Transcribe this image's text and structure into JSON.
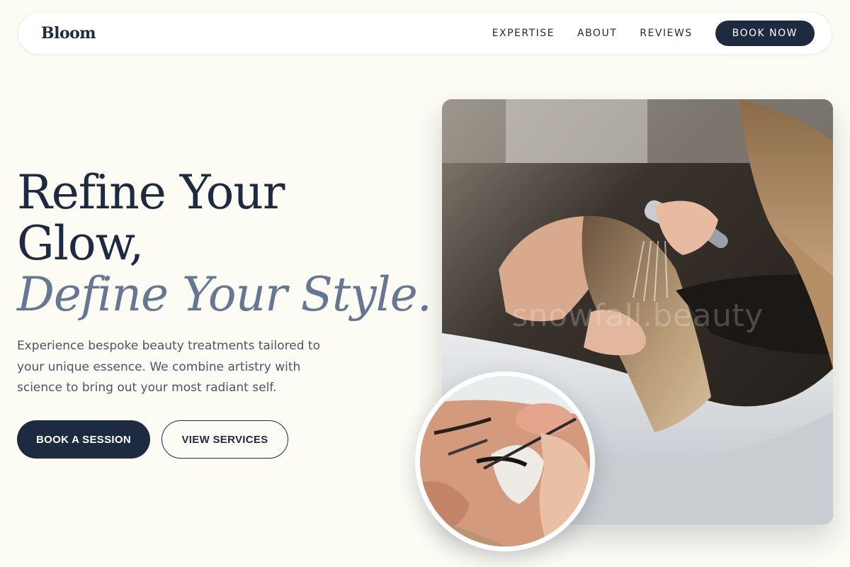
{
  "nav": {
    "logo": "Bloom",
    "links": [
      "EXPERTISE",
      "ABOUT",
      "REVIEWS"
    ],
    "cta": "BOOK NOW"
  },
  "hero": {
    "title_line1": "Refine Your",
    "title_line2": "Glow,",
    "title_accent": "Define Your Style.",
    "description": "Experience bespoke beauty treatments tailored to your unique essence. We combine artistry with science to bring out your most radiant self.",
    "primary_button": "BOOK A SESSION",
    "secondary_button": "VIEW SERVICES",
    "watermark": "snowfall.beauty"
  },
  "colors": {
    "background": "#fcfbf4",
    "navy": "#1e2a40",
    "accent_slate": "#667891",
    "body_text": "#4a5568"
  }
}
